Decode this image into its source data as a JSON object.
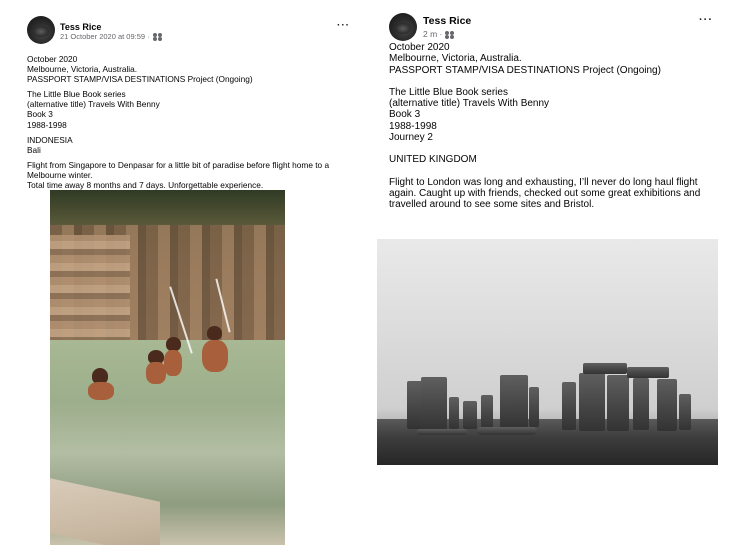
{
  "left_post": {
    "author": "Tess Rice",
    "meta": "21 October 2020 at 09:59 ·",
    "audience_icon": "friends-icon",
    "more_icon": "more-options-icon",
    "more_label": "···",
    "paragraphs": [
      "October 2020\nMelbourne, Victoria, Australia.\nPASSPORT STAMP/VISA DESTINATIONS Project (Ongoing)",
      "The Little Blue Book series\n(alternative title) Travels With Benny\nBook 3\n1988-1998",
      "INDONESIA\nBali",
      "Flight from Singapore to Denpasar for a little bit of paradise before flight home to a Melbourne winter.\nTotal time away 8 months and 7 days. Unforgettable experience."
    ]
  },
  "right_post": {
    "author": "Tess Rice",
    "meta": "2 m ·",
    "audience_icon": "friends-icon",
    "more_icon": "more-options-icon",
    "more_label": "···",
    "paragraphs": [
      "October 2020\nMelbourne, Victoria, Australia.\nPASSPORT STAMP/VISA DESTINATIONS Project (Ongoing)",
      "The Little Blue Book series\n(alternative title)  Travels With Benny\nBook 3\n1988-1998\nJourney 2",
      "UNITED KINGDOM",
      "Flight to London was long and exhausting, I’ll never do long haul flight again.  Caught up with friends, checked out some great exhibitions and travelled around to see some sites and Bristol."
    ]
  }
}
